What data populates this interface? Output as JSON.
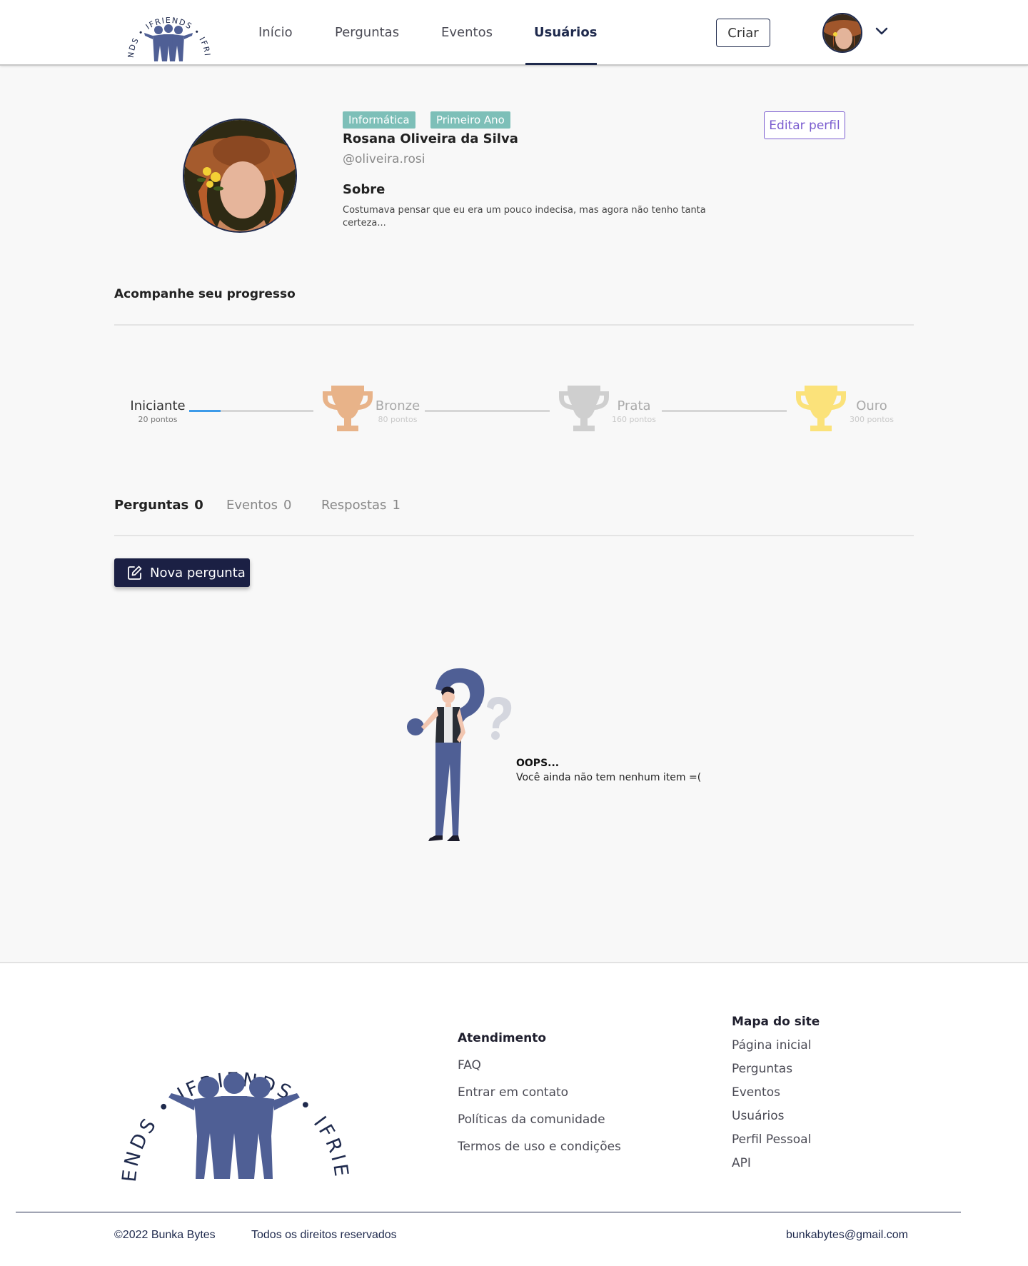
{
  "header": {
    "logo_text": "IFRIENDS",
    "nav": [
      {
        "label": "Início",
        "active": false
      },
      {
        "label": "Perguntas",
        "active": false
      },
      {
        "label": "Eventos",
        "active": false
      },
      {
        "label": "Usuários",
        "active": true
      }
    ],
    "create_label": "Criar"
  },
  "profile": {
    "badges": [
      "Informática",
      "Primeiro Ano"
    ],
    "name": "Rosana Oliveira da Silva",
    "handle": "@oliveira.rosi",
    "about_title": "Sobre",
    "about_text": "Costumava pensar que eu era um pouco indecisa, mas agora não tenho tanta certeza...",
    "edit_label": "Editar perfil"
  },
  "progress": {
    "title": "Acompanhe seu progresso",
    "fill_fraction_first_segment": 0.25,
    "levels": [
      {
        "name": "Iniciante",
        "points": "20 pontos",
        "reached": true
      },
      {
        "name": "Bronze",
        "points": "80 pontos",
        "reached": false,
        "trophy_color": "#e8b389"
      },
      {
        "name": "Prata",
        "points": "160 pontos",
        "reached": false,
        "trophy_color": "#cfcfcf"
      },
      {
        "name": "Ouro",
        "points": "300 pontos",
        "reached": false,
        "trophy_color": "#fbe27a"
      }
    ]
  },
  "tabs": [
    {
      "label": "Perguntas",
      "count": "0",
      "active": true
    },
    {
      "label": "Eventos",
      "count": "0",
      "active": false
    },
    {
      "label": "Respostas",
      "count": "1",
      "active": false
    }
  ],
  "new_question_label": "Nova pergunta",
  "empty_state": {
    "title": "OOPS...",
    "message": "Você ainda não tem nenhum item =("
  },
  "footer": {
    "logo_text": "IFRIENDS",
    "support": {
      "title": "Atendimento",
      "links": [
        "FAQ",
        "Entrar em contato",
        "Políticas da comunidade",
        "Termos de uso e condições"
      ]
    },
    "sitemap": {
      "title": "Mapa do site",
      "links": [
        "Página inicial",
        "Perguntas",
        "Eventos",
        "Usuários",
        "Perfil Pessoal",
        "API"
      ]
    },
    "copyright": "©2022 Bunka Bytes",
    "rights": "Todos os direitos reservados",
    "email": "bunkabytes@gmail.com"
  },
  "colors": {
    "brand_navy": "#1f2a4d",
    "badge_teal": "#7dbfb8",
    "edit_purple": "#7a5ccf",
    "progress_blue": "#3d9be9"
  }
}
